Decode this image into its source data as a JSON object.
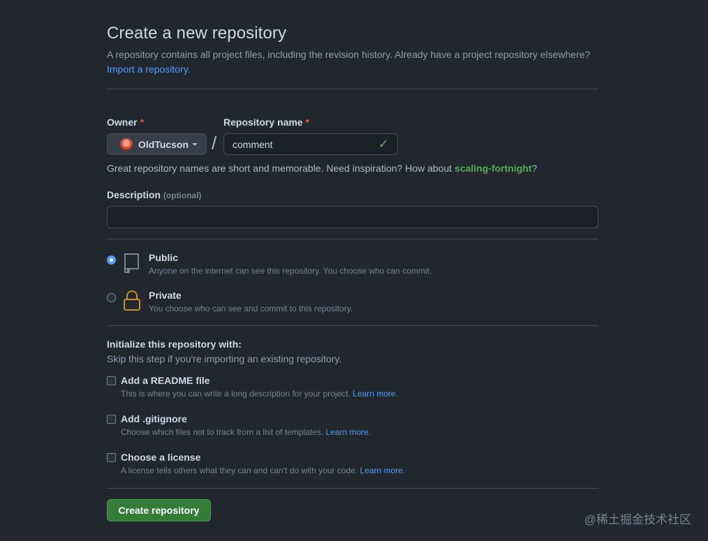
{
  "header": {
    "title": "Create a new repository",
    "subtitle": "A repository contains all project files, including the revision history. Already have a project repository elsewhere?",
    "import_link": "Import a repository."
  },
  "owner": {
    "label": "Owner",
    "required_mark": "*",
    "value": "OldTucson"
  },
  "separator": "/",
  "repo_name": {
    "label": "Repository name",
    "required_mark": "*",
    "value": "comment"
  },
  "hint": {
    "text": "Great repository names are short and memorable. Need inspiration? How about",
    "suggestion": "scaling-fortnight",
    "suffix": "?"
  },
  "description": {
    "label": "Description",
    "optional": "(optional)",
    "value": ""
  },
  "visibility": {
    "public": {
      "title": "Public",
      "desc": "Anyone on the internet can see this repository. You choose who can commit.",
      "selected": true
    },
    "private": {
      "title": "Private",
      "desc": "You choose who can see and commit to this repository.",
      "selected": false
    }
  },
  "init": {
    "title": "Initialize this repository with:",
    "subtitle": "Skip this step if you're importing an existing repository.",
    "options": [
      {
        "title": "Add a README file",
        "desc": "This is where you can write a long description for your project.",
        "link": "Learn more."
      },
      {
        "title": "Add .gitignore",
        "desc": "Choose which files not to track from a list of templates.",
        "link": "Learn more."
      },
      {
        "title": "Choose a license",
        "desc": "A license tells others what they can and can't do with your code.",
        "link": "Learn more."
      }
    ]
  },
  "submit": {
    "label": "Create repository"
  },
  "watermark": "@稀土掘金技术社区",
  "colors": {
    "background": "#22272e",
    "accent_link": "#539bf5",
    "success": "#57ab5a",
    "danger": "#e5534b",
    "primary_button": "#347d39"
  }
}
